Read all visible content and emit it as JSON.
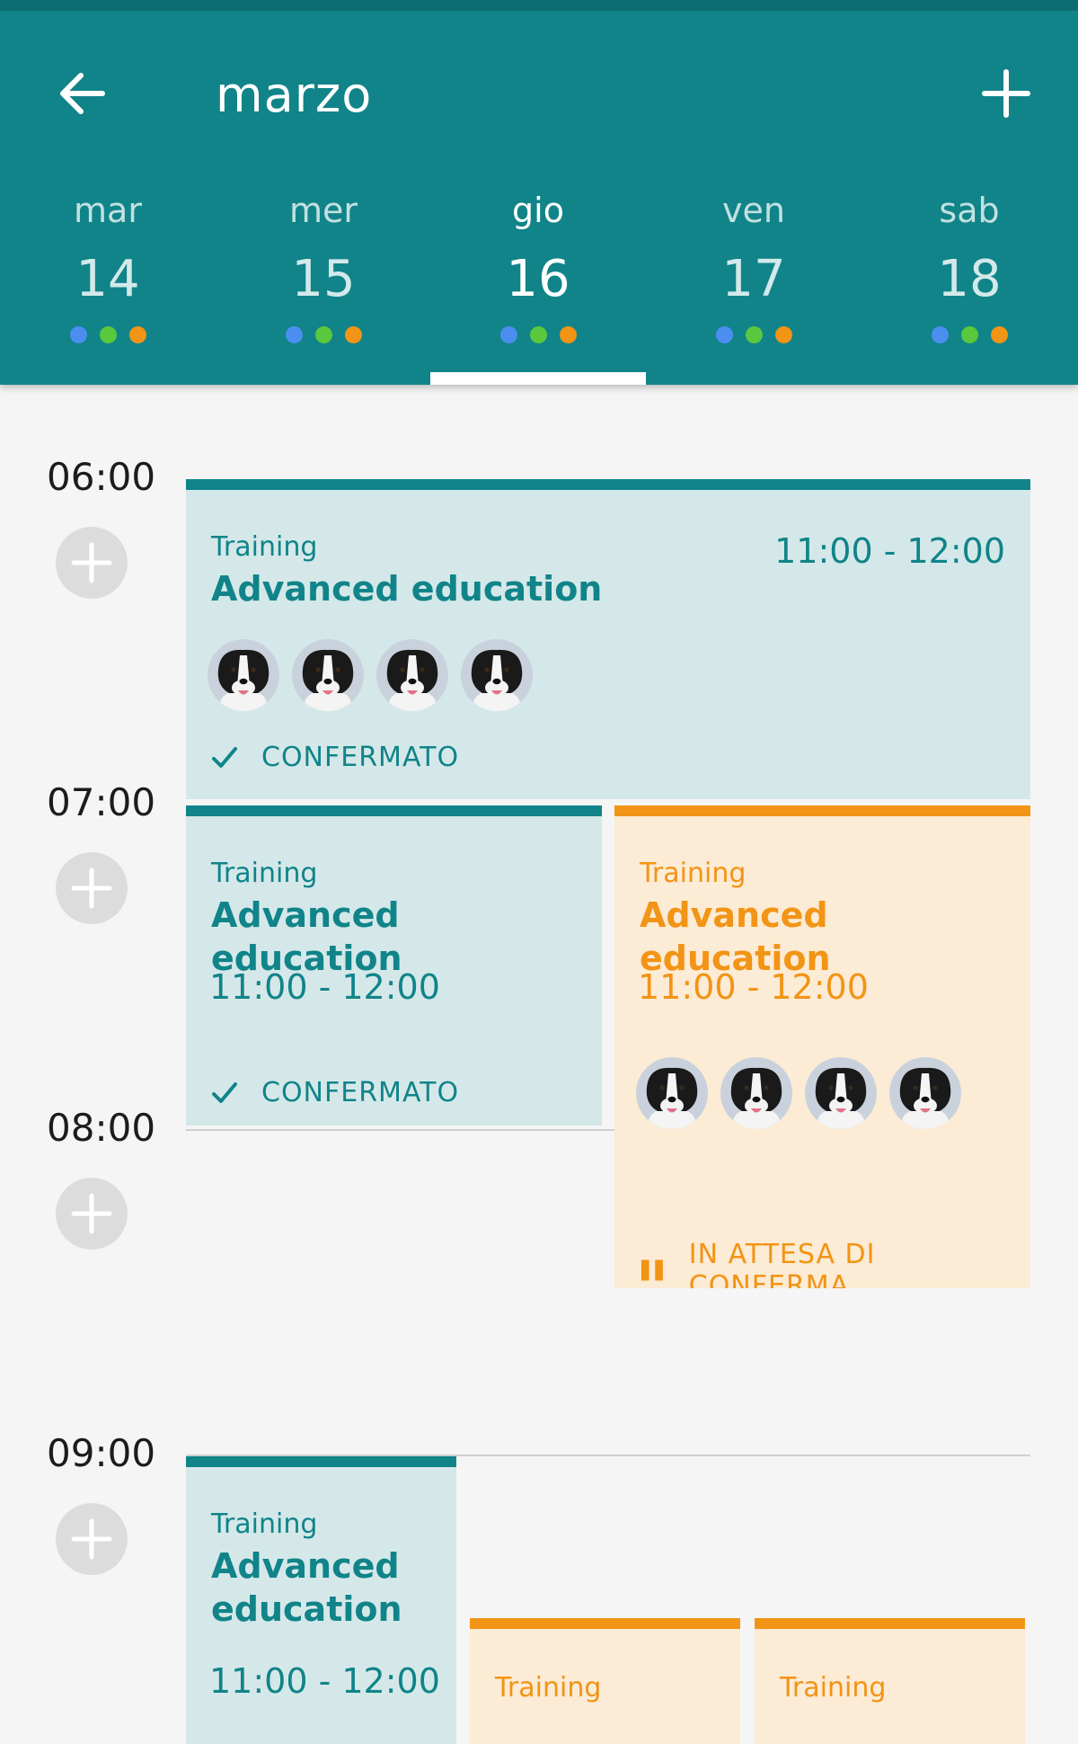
{
  "header": {
    "month": "marzo",
    "back_icon": "arrow-left-icon",
    "add_icon": "plus-icon",
    "days": [
      {
        "name": "mar",
        "number": "14",
        "selected": false
      },
      {
        "name": "mer",
        "number": "15",
        "selected": false
      },
      {
        "name": "gio",
        "number": "16",
        "selected": true
      },
      {
        "name": "ven",
        "number": "17",
        "selected": false
      },
      {
        "name": "sab",
        "number": "18",
        "selected": false
      }
    ],
    "dot_colors": [
      "#4c8ef0",
      "#5ac83d",
      "#f29415"
    ]
  },
  "hours": [
    "06:00",
    "07:00",
    "08:00",
    "09:00"
  ],
  "colors": {
    "teal": "#108489",
    "teal_bg": "#d5e8e9",
    "orange": "#f29415",
    "orange_bg": "#fcebd5"
  },
  "events": [
    {
      "category": "Training",
      "title": "Advanced education",
      "time": "11:00 - 12:00",
      "status": "CONFERMATO",
      "status_icon": "check-icon",
      "avatar_count": 4
    },
    {
      "category": "Training",
      "title": "Advanced education",
      "time": "11:00 - 12:00",
      "status": "CONFERMATO",
      "status_icon": "check-icon"
    },
    {
      "category": "Training",
      "title": "Advanced education",
      "time": "11:00 - 12:00",
      "status": "IN ATTESA DI CONFERMA",
      "status_icon": "pause-icon",
      "avatar_count": 4
    },
    {
      "category": "Training",
      "title": "Advanced education",
      "time": "11:00 - 12:00"
    },
    {
      "category": "Training"
    },
    {
      "category": "Training"
    }
  ]
}
